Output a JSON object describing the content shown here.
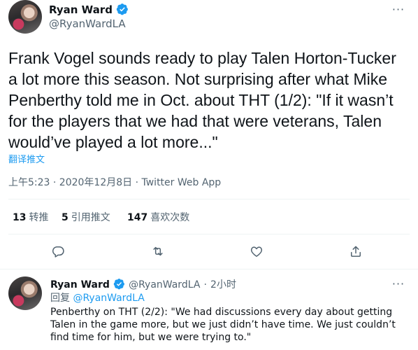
{
  "tweet": {
    "author_name": "Ryan Ward",
    "author_handle": "@RyanWardLA",
    "text": "Frank Vogel sounds ready to play Talen Horton-Tucker a lot more this season. Not surprising after what Mike Penberthy told me in Oct. about THT (1/2): \"If it wasn’t for the players that we had that were veterans, Talen would’ve played a lot more...\"",
    "translate_label": "翻译推文",
    "timestamp": "上午5:23 · 2020年12月8日 · Twitter Web App",
    "stats": {
      "retweets_count": "13",
      "retweets_label": "转推",
      "quotes_count": "5",
      "quotes_label": "引用推文",
      "likes_count": "147",
      "likes_label": "喜欢次数"
    },
    "more_glyph": "···"
  },
  "reply": {
    "author_name": "Ryan Ward",
    "author_handle": "@RyanWardLA",
    "dot": "·",
    "time_ago": "2小时",
    "replying_label": "回复",
    "replying_to": "@RyanWardLA",
    "text": "Penberthy on THT (2/2): \"We had discussions every day about getting Talen in the game more, but we just didn’t have time. We just couldn’t find time for him, but we were trying to.\"",
    "more_glyph": "···"
  },
  "colors": {
    "accent": "#1d9bf0",
    "muted": "#536471",
    "divider": "#eff3f4",
    "text": "#0f1419"
  },
  "icons": [
    "verified-badge-icon",
    "more-options-icon",
    "reply-icon",
    "retweet-icon",
    "like-icon",
    "share-icon"
  ]
}
